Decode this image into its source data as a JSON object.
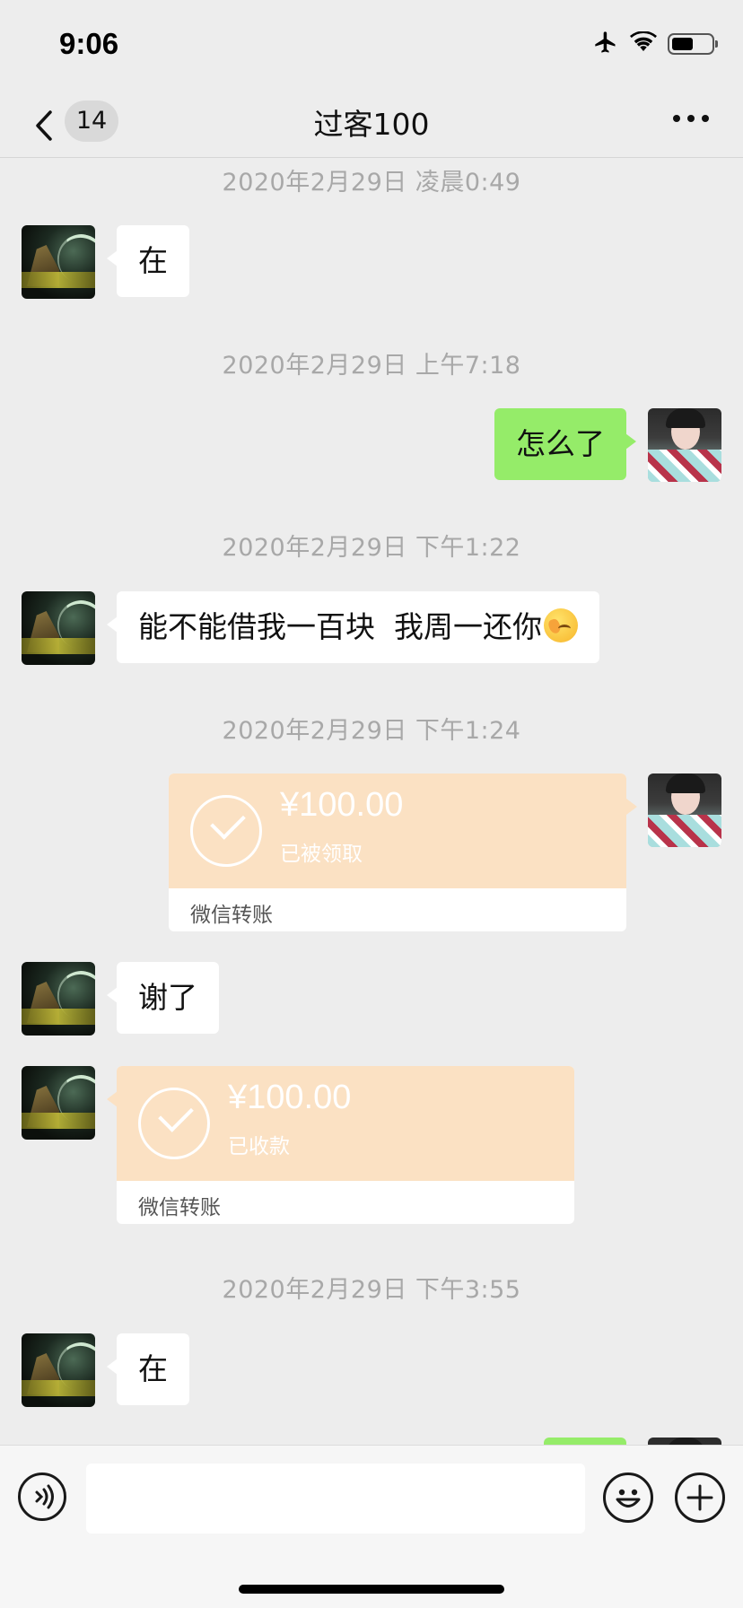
{
  "status_bar": {
    "time": "9:06",
    "icons": [
      "airplane-icon",
      "wifi-icon",
      "battery-icon"
    ],
    "battery_level": 0.55
  },
  "nav": {
    "unread_count": "14",
    "title": "过客100",
    "more_icon": "more-icon"
  },
  "messages": {
    "ts1": "2020年2月29日 凌晨0:49",
    "m1": "在",
    "ts2": "2020年2月29日 上午7:18",
    "m2": "怎么了",
    "ts3": "2020年2月29日 下午1:22",
    "m3": "能不能借我一百块  我周一还你",
    "m3_emoji": "face-with-hand-over-eyes",
    "ts4": "2020年2月29日 下午1:24",
    "transfer1": {
      "amount": "¥100.00",
      "status": "已被领取",
      "label": "微信转账"
    },
    "m4": "谢了",
    "transfer2": {
      "amount": "¥100.00",
      "status": "已收款",
      "label": "微信转账"
    },
    "ts5": "2020年2月29日 下午3:55",
    "m5": "在"
  },
  "input_bar": {
    "placeholder": "",
    "icons": [
      "voice-icon",
      "emoji-icon",
      "plus-icon"
    ]
  },
  "colors": {
    "background": "#ededed",
    "bubble_sent": "#95ec69",
    "bubble_received": "#ffffff",
    "transfer": "#fbe1c3"
  }
}
